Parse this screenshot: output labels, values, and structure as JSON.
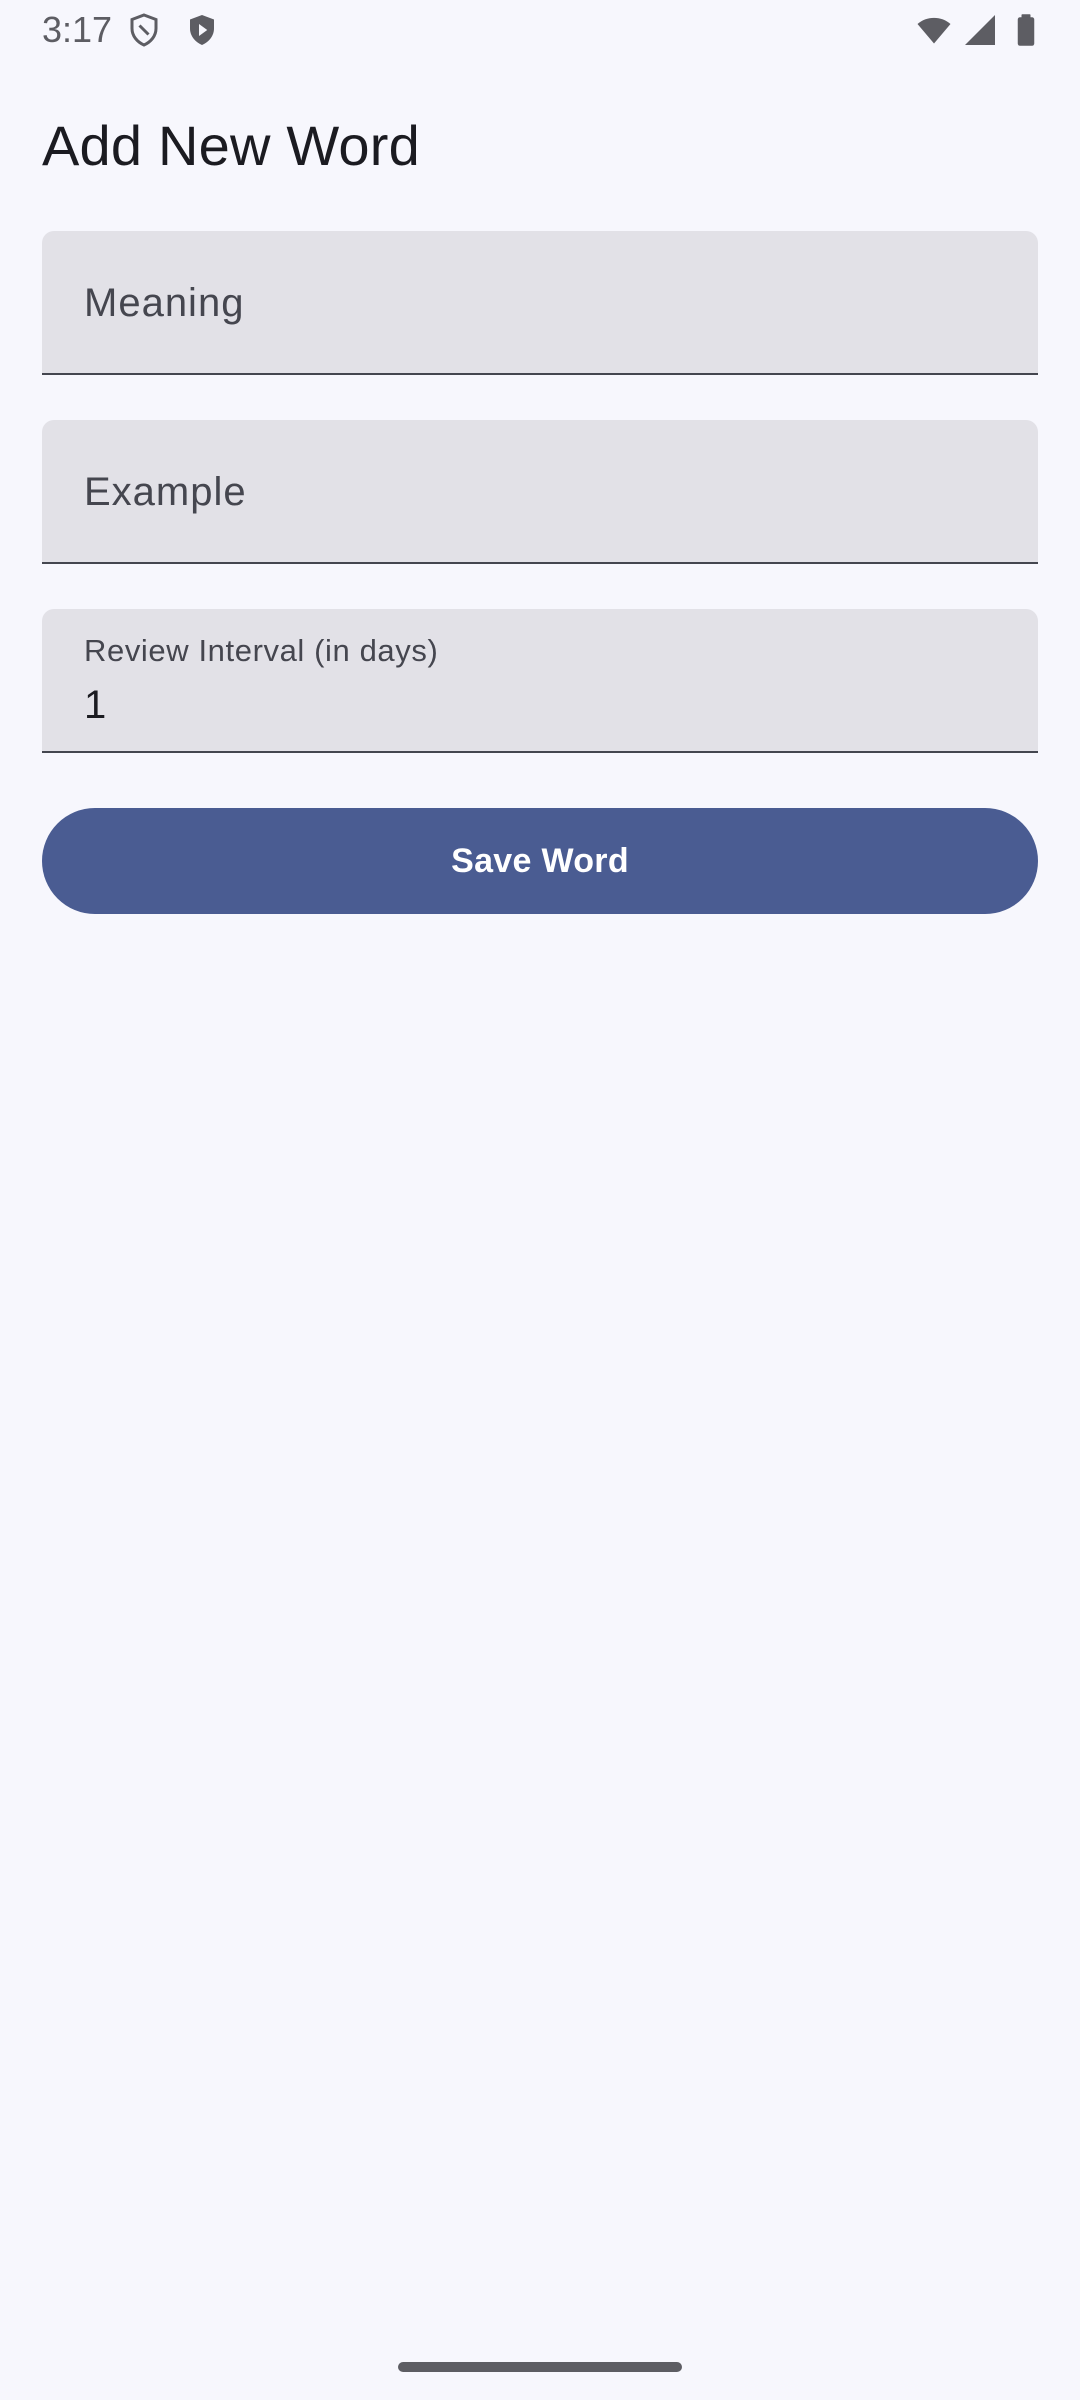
{
  "status_bar": {
    "time": "3:17",
    "left_icons": [
      "shield-icon",
      "play-protect-icon"
    ],
    "right_icons": [
      "wifi-icon",
      "cellular-signal-icon",
      "battery-icon"
    ]
  },
  "page": {
    "title": "Add New Word"
  },
  "form": {
    "meaning": {
      "placeholder": "Meaning",
      "value": ""
    },
    "example": {
      "placeholder": "Example",
      "value": ""
    },
    "review_interval": {
      "label": "Review Interval (in days)",
      "value": "1"
    },
    "save_label": "Save Word"
  },
  "colors": {
    "background": "#f7f7fd",
    "field_fill": "#e2e1e7",
    "primary": "#4a5c92",
    "on_primary": "#ffffff"
  }
}
